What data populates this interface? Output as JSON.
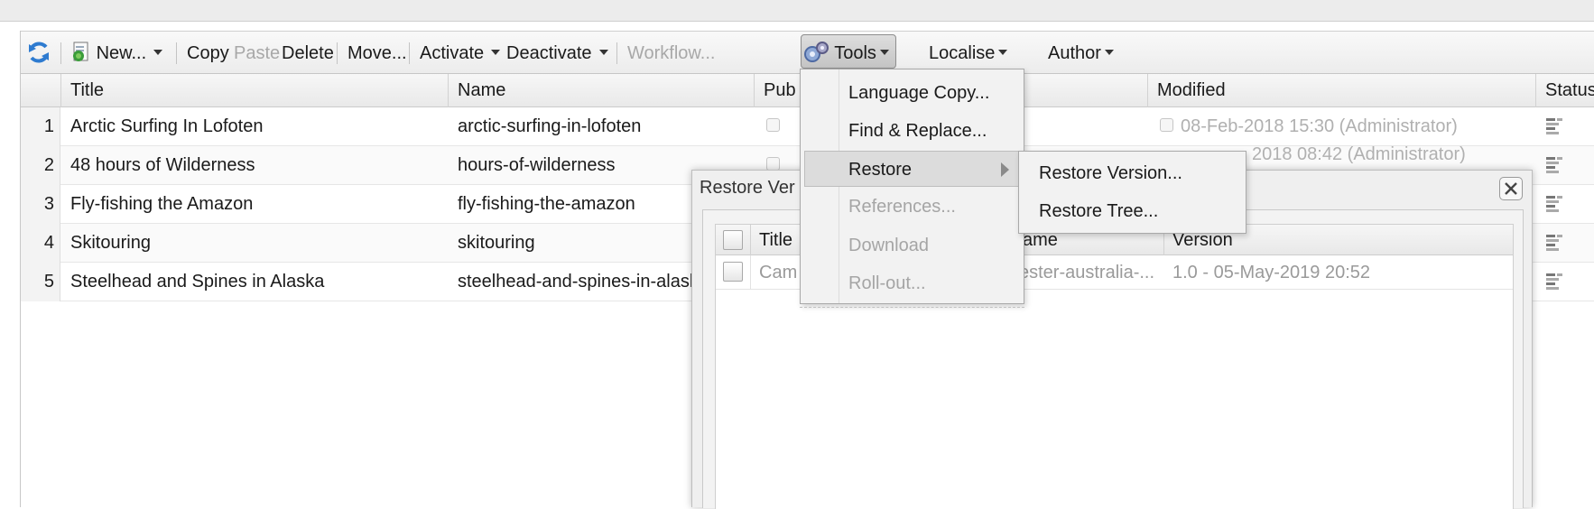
{
  "toolbar": {
    "new": "New...",
    "copy": "Copy",
    "paste": "Paste",
    "delete": "Delete",
    "move": "Move...",
    "activate": "Activate",
    "deactivate": "Deactivate",
    "workflow": "Workflow...",
    "tools": "Tools",
    "localise": "Localise",
    "author": "Author"
  },
  "grid": {
    "columns": [
      "Title",
      "Name",
      "Pub",
      "Modified",
      "Status"
    ],
    "rows": [
      {
        "num": "1",
        "title": "Arctic Surfing In Lofoten",
        "name": "arctic-surfing-in-lofoten",
        "modified": "08-Feb-2018 15:30 (Administrator)"
      },
      {
        "num": "2",
        "title": "48 hours of Wilderness",
        "name": "hours-of-wilderness",
        "modified": "2018 08:42 (Administrator)"
      },
      {
        "num": "3",
        "title": "Fly-fishing the Amazon",
        "name": "fly-fishing-the-amazon",
        "modified": ""
      },
      {
        "num": "4",
        "title": "Skitouring",
        "name": "skitouring",
        "modified": ""
      },
      {
        "num": "5",
        "title": "Steelhead and Spines in Alaska",
        "name": "steelhead-and-spines-in-alask",
        "modified": ""
      }
    ]
  },
  "dialog": {
    "title": "Restore Ver",
    "columns": {
      "title": "Title",
      "name": "ame",
      "version": "Version"
    },
    "row": {
      "title": "Cam",
      "name": "ester-australia-...",
      "version": "1.0 - 05-May-2019 20:52"
    }
  },
  "tools_menu": {
    "items": [
      "Language Copy...",
      "Find & Replace...",
      "Restore",
      "References...",
      "Download",
      "Roll-out..."
    ]
  },
  "restore_submenu": {
    "items": [
      "Restore Version...",
      "Restore Tree..."
    ]
  },
  "colors": {
    "accent": "#2e7bd0",
    "disabled": "#a8a8a8"
  },
  "icons": [
    "refresh-icon",
    "new-page-icon",
    "tools-gear-icon",
    "close-icon",
    "status-icon",
    "submenu-arrow-icon"
  ]
}
